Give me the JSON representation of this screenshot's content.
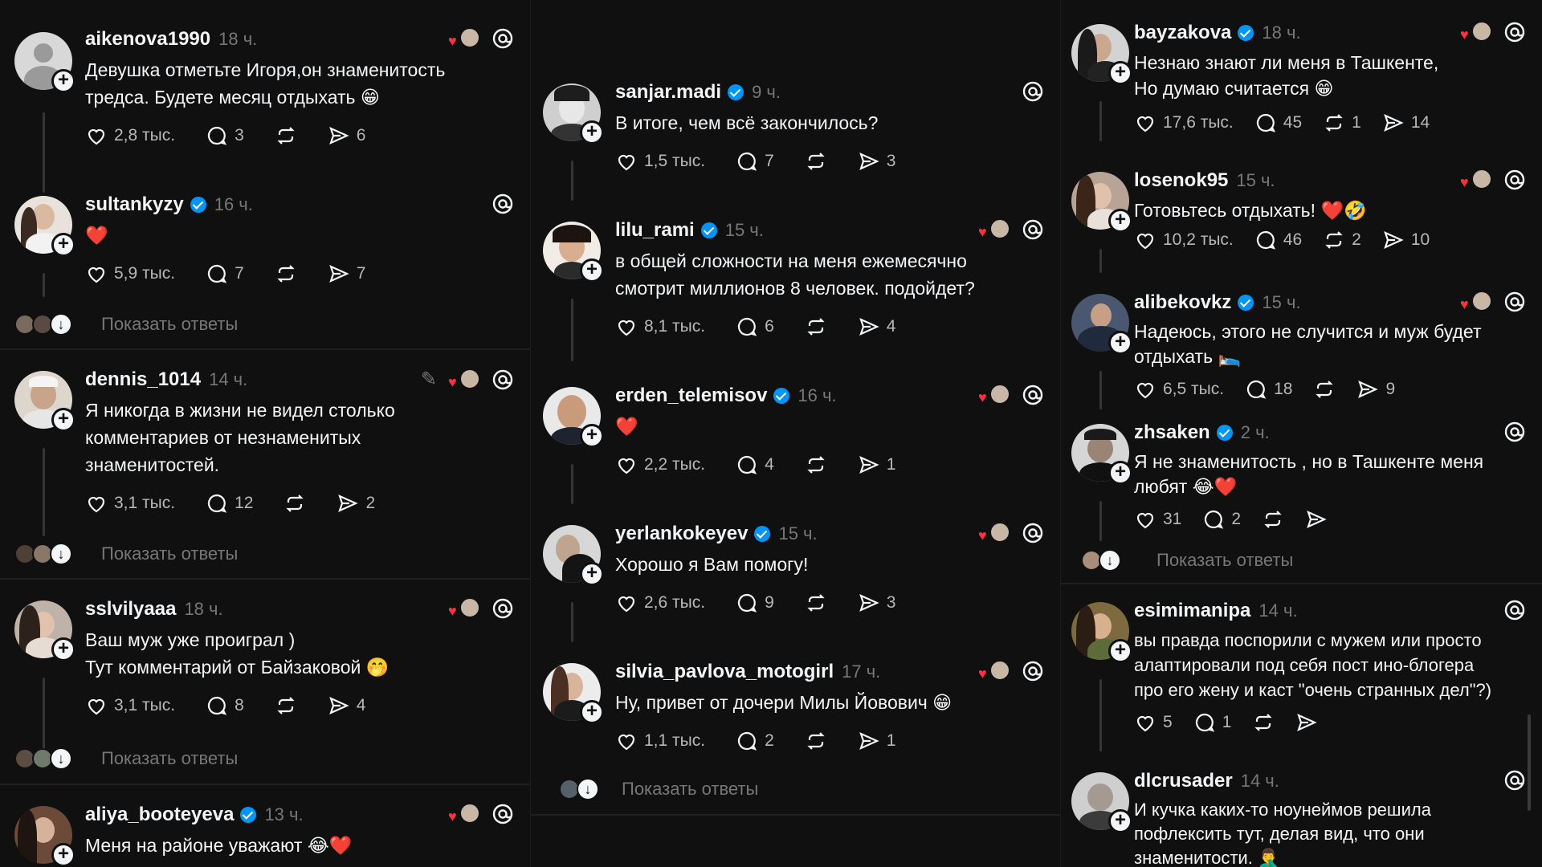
{
  "common": {
    "show_replies_label": "Показать ответы"
  },
  "columns": [
    {
      "posts": [
        {
          "username": "aikenova1990",
          "verified": false,
          "time": "18 ч.",
          "liked_by_author": true,
          "text": "Девушка отметьте Игоря,он знаменитость\nтредса. Будете месяц отдыхать 😁",
          "likes": "2,8 тыс.",
          "comments": "3",
          "reposts": "",
          "shares": "6"
        },
        {
          "username": "sultankyzy",
          "verified": true,
          "time": "16 ч.",
          "liked_by_author": false,
          "text": "❤️",
          "likes": "5,9 тыс.",
          "comments": "7",
          "reposts": "",
          "shares": "7"
        },
        {
          "username": "dennis_1014",
          "verified": false,
          "time": "14 ч.",
          "liked_by_author": true,
          "text": "Я никогда в жизни не видел столько\nкомментариев от незнаменитых\nзнаменитостей.",
          "likes": "3,1 тыс.",
          "comments": "12",
          "reposts": "",
          "shares": "2"
        },
        {
          "username": "sslvilyaaa",
          "verified": false,
          "time": "18 ч.",
          "liked_by_author": true,
          "text": "Ваш муж уже проиграл )\nТут комментарий от Байзаковой 🤭",
          "likes": "3,1 тыс.",
          "comments": "8",
          "reposts": "",
          "shares": "4"
        },
        {
          "username": "aliya_booteyeva",
          "verified": true,
          "time": "13 ч.",
          "liked_by_author": true,
          "text": "Меня на районе уважают 😂❤️",
          "likes": "",
          "comments": "",
          "reposts": "",
          "shares": ""
        }
      ]
    },
    {
      "posts": [
        {
          "username": "sanjar.madi",
          "verified": true,
          "time": "9 ч.",
          "liked_by_author": false,
          "text": "В итоге, чем всё закончилось?",
          "likes": "1,5 тыс.",
          "comments": "7",
          "reposts": "",
          "shares": "3"
        },
        {
          "username": "lilu_rami",
          "verified": true,
          "time": "15 ч.",
          "liked_by_author": true,
          "text": "в общей сложности на меня ежемесячно\nсмотрит миллионов 8 человек. подойдет?",
          "likes": "8,1 тыс.",
          "comments": "6",
          "reposts": "",
          "shares": "4"
        },
        {
          "username": "erden_telemisov",
          "verified": true,
          "time": "16 ч.",
          "liked_by_author": true,
          "text": "❤️",
          "likes": "2,2 тыс.",
          "comments": "4",
          "reposts": "",
          "shares": "1"
        },
        {
          "username": "yerlankokeyev",
          "verified": true,
          "time": "15 ч.",
          "liked_by_author": true,
          "text": "Хорошо я Вам помогу!",
          "likes": "2,6 тыс.",
          "comments": "9",
          "reposts": "",
          "shares": "3"
        },
        {
          "username": "silvia_pavlova_motogirl",
          "verified": false,
          "time": "17 ч.",
          "liked_by_author": true,
          "text": "Ну, привет от дочери Милы Йовович 😁",
          "likes": "1,1 тыс.",
          "comments": "2",
          "reposts": "",
          "shares": "1"
        }
      ]
    },
    {
      "posts": [
        {
          "username": "bayzakova",
          "verified": true,
          "time": "18 ч.",
          "liked_by_author": true,
          "text": "Незнаю знают ли меня в Ташкенте,\nНо думаю считается 😁",
          "likes": "17,6 тыс.",
          "comments": "45",
          "reposts": "1",
          "shares": "14"
        },
        {
          "username": "losenok95",
          "verified": false,
          "time": "15 ч.",
          "liked_by_author": true,
          "text": "Готовьтесь отдыхать! ❤️🤣",
          "likes": "10,2 тыс.",
          "comments": "46",
          "reposts": "2",
          "shares": "10"
        },
        {
          "username": "alibekovkz",
          "verified": true,
          "time": "15 ч.",
          "liked_by_author": true,
          "text": "Надеюсь, этого не случится и муж будет\nотдыхать 🛌",
          "likes": "6,5 тыс.",
          "comments": "18",
          "reposts": "",
          "shares": "9"
        },
        {
          "username": "zhsaken",
          "verified": true,
          "time": "2 ч.",
          "liked_by_author": false,
          "text": "Я не знаменитость , но в Ташкенте меня\nлюбят 😂❤️",
          "likes": "31",
          "comments": "2",
          "reposts": "",
          "shares": ""
        },
        {
          "username": "esimimanipa",
          "verified": false,
          "time": "14 ч.",
          "liked_by_author": false,
          "text": "вы правда поспорили с мужем или просто\nалаптировали под себя пост ино-блогера\nпро его жену и каст \"очень странных дел\"?)",
          "likes": "5",
          "comments": "1",
          "reposts": "",
          "shares": ""
        },
        {
          "username": "dlcrusader",
          "verified": false,
          "time": "14 ч.",
          "liked_by_author": false,
          "text": "И кучка каких-то ноунеймов решила\nпофлексить тут, делая вид, что они\nзнаменитости. 🤦‍♂️",
          "likes": "",
          "comments": "",
          "reposts": "",
          "shares": ""
        }
      ]
    }
  ],
  "colors": {
    "background": "#101010",
    "text": "#f3f5f7",
    "muted": "#777777",
    "verified": "#0095f6",
    "heart": "#ff3040"
  }
}
